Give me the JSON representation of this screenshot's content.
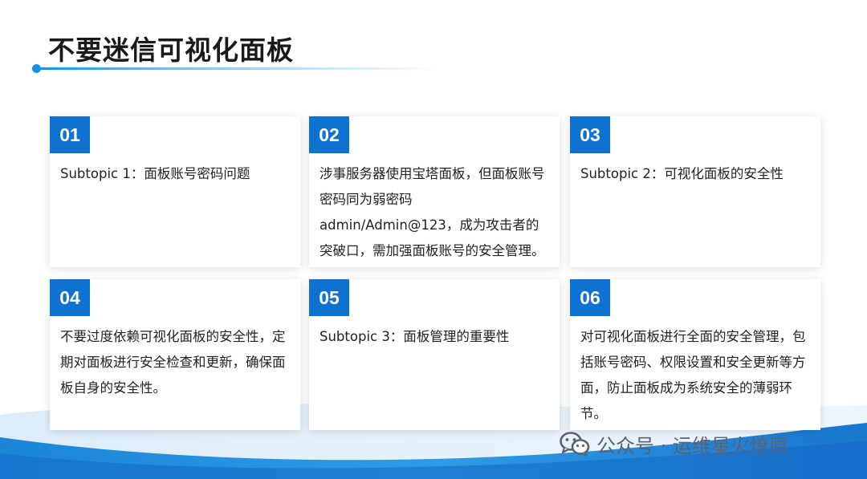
{
  "title": "不要迷信可视化面板",
  "cards": [
    {
      "num": "01",
      "text": "Subtopic 1：面板账号密码问题"
    },
    {
      "num": "02",
      "text": "涉事服务器使用宝塔面板，但面板账号密码同为弱密码admin/Admin@123，成为攻击者的突破口，需加强面板账号的安全管理。"
    },
    {
      "num": "03",
      "text": "Subtopic 2：可视化面板的安全性"
    },
    {
      "num": "04",
      "text": "不要过度依赖可视化面板的安全性，定期对面板进行安全检查和更新，确保面板自身的安全性。"
    },
    {
      "num": "05",
      "text": "Subtopic 3：面板管理的重要性"
    },
    {
      "num": "06",
      "text": "对可视化面板进行全面的安全管理，包括账号密码、权限设置和安全更新等方面，防止面板成为系统安全的薄弱环节。"
    }
  ],
  "watermark": {
    "text": "公众号 · 运维星火燎原",
    "icon": "wechat-icon"
  },
  "colors": {
    "accent": "#0f72d0",
    "title_line": "#1a8fe8"
  }
}
